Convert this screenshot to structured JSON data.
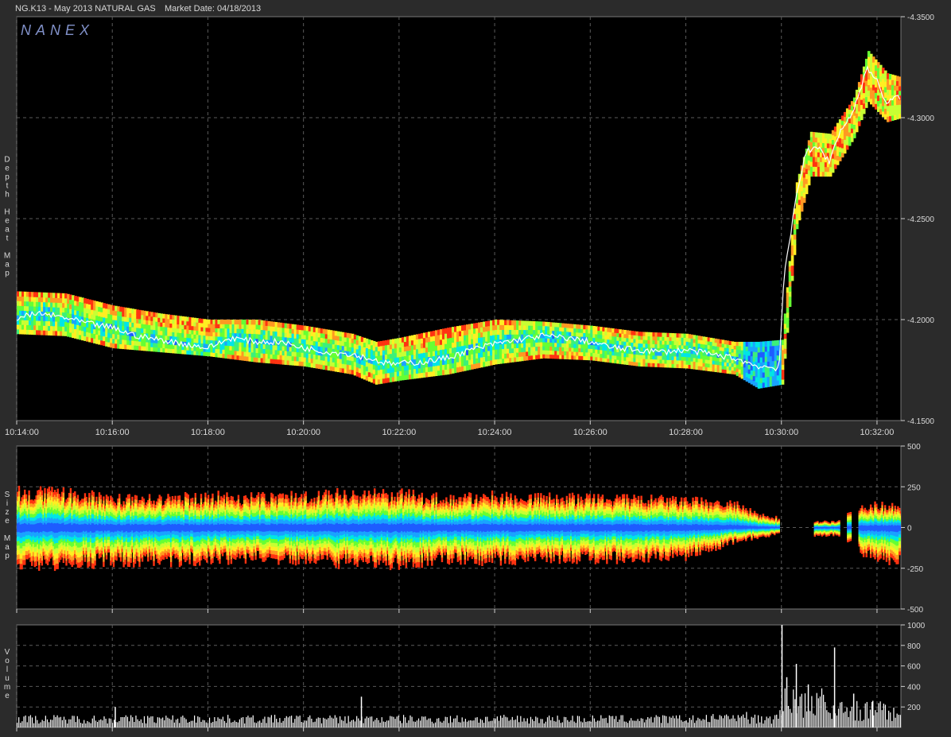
{
  "header": {
    "symbol": "NG.K13 - May 2013 NATURAL GAS",
    "market_date": "Market Date: 04/18/2013"
  },
  "watermark": "NANEX",
  "colors": {
    "background": "#000000",
    "frame": "#2b2b2b",
    "grid": "#5a5a5a",
    "heat_scale": [
      "#1e5cff",
      "#1aa3ff",
      "#00e5e5",
      "#3cf07a",
      "#66ff33",
      "#c8ff33",
      "#ffee22",
      "#ff9922",
      "#ff3311"
    ],
    "price_line": "#ffffff"
  },
  "chart_data": [
    {
      "type": "heatmap",
      "title": "",
      "ylabel": "Depth Heat Map",
      "ylim": [
        4.15,
        4.35
      ],
      "y_ticks": [
        "4.1500",
        "4.2000",
        "4.2500",
        "4.3000",
        "4.3500"
      ],
      "x_ticks": [
        "10:14:00",
        "10:16:00",
        "10:18:00",
        "10:20:00",
        "10:22:00",
        "10:24:00",
        "10:26:00",
        "10:28:00",
        "10:30:00",
        "10:32:00"
      ],
      "xlim_minutes": [
        0,
        18.5
      ],
      "trade_price": {
        "minutes": [
          0,
          0.5,
          1,
          1.5,
          2,
          2.5,
          3,
          3.5,
          4,
          4.5,
          5,
          5.5,
          6,
          6.5,
          7,
          7.5,
          7.8,
          8.5,
          9,
          9.5,
          10,
          10.5,
          11,
          11.5,
          12,
          12.5,
          13,
          13.5,
          14,
          14.5,
          15,
          15.5,
          15.95,
          16.05,
          16.15,
          16.3,
          16.5,
          16.8,
          17,
          17.2,
          17.5,
          17.8,
          18,
          18.2,
          18.4
        ],
        "values": [
          4.201,
          4.203,
          4.201,
          4.198,
          4.196,
          4.192,
          4.19,
          4.188,
          4.186,
          4.191,
          4.189,
          4.189,
          4.186,
          4.184,
          4.183,
          4.18,
          4.178,
          4.179,
          4.181,
          4.185,
          4.188,
          4.19,
          4.192,
          4.191,
          4.189,
          4.186,
          4.185,
          4.184,
          4.185,
          4.183,
          4.181,
          4.177,
          4.176,
          4.22,
          4.235,
          4.26,
          4.283,
          4.285,
          4.278,
          4.292,
          4.303,
          4.325,
          4.318,
          4.307,
          4.31
        ]
      },
      "depth_band": {
        "minutes": [
          0,
          1,
          2,
          3,
          4,
          5,
          6,
          7,
          7.5,
          8,
          9,
          10,
          11,
          12,
          13,
          14,
          15,
          15.5,
          16,
          16.3,
          16.6,
          17,
          17.5,
          17.8,
          18.2,
          18.5
        ],
        "upper": [
          4.214,
          4.213,
          4.207,
          4.203,
          4.2,
          4.2,
          4.197,
          4.193,
          4.189,
          4.191,
          4.196,
          4.2,
          4.199,
          4.197,
          4.194,
          4.193,
          4.189,
          4.189,
          4.19,
          4.268,
          4.293,
          4.292,
          4.31,
          4.333,
          4.322,
          4.32
        ],
        "lower": [
          4.193,
          4.192,
          4.186,
          4.184,
          4.182,
          4.179,
          4.177,
          4.173,
          4.168,
          4.17,
          4.173,
          4.178,
          4.181,
          4.18,
          4.177,
          4.176,
          4.173,
          4.166,
          4.168,
          4.245,
          4.271,
          4.271,
          4.29,
          4.308,
          4.298,
          4.3
        ]
      }
    },
    {
      "type": "area",
      "ylabel": "Size Map",
      "ylim": [
        -500,
        500
      ],
      "y_ticks": [
        "500",
        "250",
        "0",
        "-250",
        "-500"
      ],
      "xlim_minutes": [
        0,
        18.5
      ],
      "segments": [
        [
          0,
          15.95
        ],
        [
          16.65,
          17.2
        ],
        [
          17.35,
          17.45
        ],
        [
          17.6,
          18.5
        ]
      ],
      "ask_envelope": {
        "minutes": [
          0,
          1,
          2,
          3,
          4,
          5,
          6,
          7,
          7.5,
          8,
          9,
          10,
          11,
          12,
          13,
          14,
          15,
          15.5,
          15.95,
          16.65,
          17.2,
          17.6,
          18.5
        ],
        "values": [
          225,
          215,
          185,
          180,
          200,
          190,
          205,
          215,
          210,
          210,
          185,
          200,
          190,
          185,
          180,
          170,
          150,
          80,
          60,
          40,
          40,
          140,
          140
        ]
      },
      "bid_envelope": {
        "minutes": [
          0,
          1,
          2,
          3,
          4,
          5,
          6,
          7,
          7.5,
          8,
          9,
          10,
          11,
          12,
          13,
          14,
          15,
          15.5,
          15.95,
          16.65,
          17.2,
          17.6,
          18.5
        ],
        "values": [
          -240,
          -235,
          -210,
          -215,
          -205,
          -195,
          -210,
          -225,
          -220,
          -230,
          -205,
          -205,
          -195,
          -200,
          -190,
          -180,
          -90,
          -60,
          -40,
          -50,
          -50,
          -150,
          -230
        ]
      }
    },
    {
      "type": "bar",
      "ylabel": "Volume",
      "ylim": [
        0,
        1000
      ],
      "y_ticks": [
        "1000",
        "800",
        "600",
        "400",
        "200"
      ],
      "xlim_minutes": [
        0,
        18.5
      ],
      "baseline_volume": 95,
      "spikes": [
        {
          "minute": 2.05,
          "value": 200
        },
        {
          "minute": 7.2,
          "value": 300
        },
        {
          "minute": 16.0,
          "value": 1000
        },
        {
          "minute": 16.1,
          "value": 490
        },
        {
          "minute": 16.3,
          "value": 620
        },
        {
          "minute": 16.55,
          "value": 420
        },
        {
          "minute": 17.1,
          "value": 780
        },
        {
          "minute": 17.5,
          "value": 330
        },
        {
          "minute": 17.9,
          "value": 260
        }
      ],
      "active_volume": [
        {
          "from": 14.5,
          "to": 15.95,
          "value": 120
        },
        {
          "from": 15.95,
          "to": 17.0,
          "value": 300
        },
        {
          "from": 17.0,
          "to": 18.5,
          "value": 200
        }
      ]
    }
  ]
}
